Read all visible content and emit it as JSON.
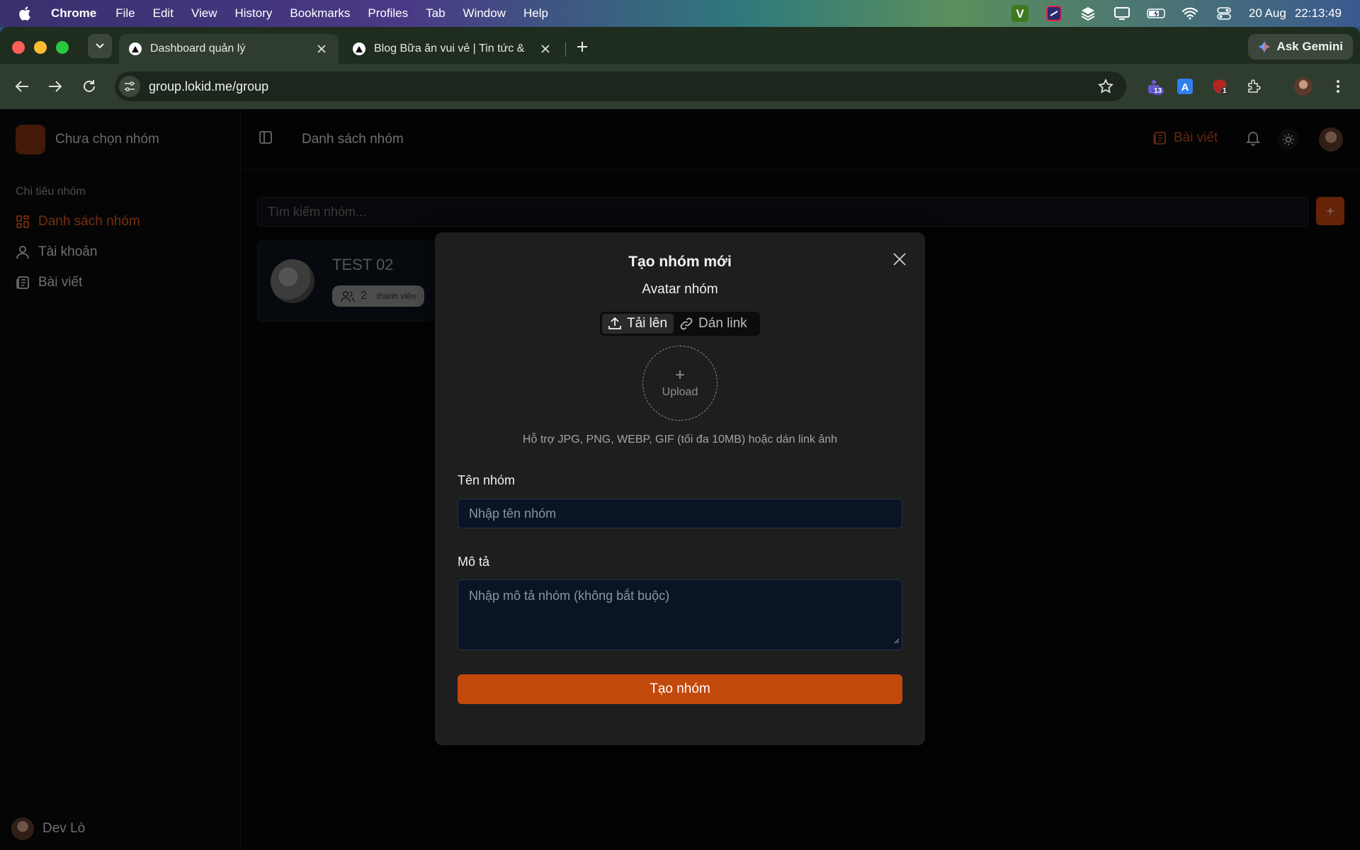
{
  "menubar": {
    "app_name": "Chrome",
    "items": [
      "File",
      "Edit",
      "View",
      "History",
      "Bookmarks",
      "Profiles",
      "Tab",
      "Window",
      "Help"
    ],
    "date": "20 Aug",
    "time": "22:13:49",
    "status_icons": [
      "v-app-icon",
      "screen-tool-icon",
      "layers-icon",
      "display-icon",
      "battery-icon",
      "wifi-icon",
      "control-center-icon"
    ]
  },
  "browser": {
    "tabs": [
      {
        "title": "Dashboard quản lý",
        "active": true
      },
      {
        "title": "Blog Bữa ăn vui vẻ | Tin tức &",
        "active": false
      }
    ],
    "ask_gemini": "Ask Gemini",
    "url": "group.lokid.me/group",
    "extensions": [
      {
        "name": "extension-badge-icon",
        "badge": "13"
      },
      {
        "name": "translate-extension-icon",
        "badge": ""
      },
      {
        "name": "shield-extension-icon",
        "badge": "1"
      },
      {
        "name": "puzzle-extensions-icon",
        "badge": ""
      }
    ]
  },
  "sidebar": {
    "group_name": "Chưa chọn nhóm",
    "section_label": "Chi tiêu nhóm",
    "items": [
      {
        "label": "Danh sách nhóm",
        "icon": "grid-icon",
        "active": true
      },
      {
        "label": "Tài khoản",
        "icon": "user-icon",
        "active": false
      },
      {
        "label": "Bài viết",
        "icon": "newspaper-icon",
        "active": false
      }
    ],
    "user_name": "Dev Lò"
  },
  "topbar": {
    "breadcrumb": "Danh sách nhóm",
    "posts_link": "Bài viết"
  },
  "main": {
    "search_placeholder": "Tìm kiếm nhóm...",
    "add_label": "+",
    "groups": [
      {
        "name": "TEST 02",
        "member_count": "2",
        "member_label": "thành viên"
      }
    ]
  },
  "modal": {
    "title": "Tạo nhóm mới",
    "avatar_label": "Avatar nhóm",
    "tab_upload": "Tải lên",
    "tab_link": "Dán link",
    "upload_plus": "+",
    "upload_text": "Upload",
    "hint": "Hỗ trợ JPG, PNG, WEBP, GIF (tối đa 10MB) hoặc dán link ảnh",
    "name_label": "Tên nhóm",
    "name_placeholder": "Nhập tên nhóm",
    "desc_label": "Mô tả",
    "desc_placeholder": "Nhập mô tả nhóm (không bắt buộc)",
    "submit_label": "Tạo nhóm"
  },
  "colors": {
    "accent": "#c2490c",
    "active_nav": "#d9541a",
    "modal_bg": "#1e1e1e",
    "input_bg": "#0b1424"
  }
}
